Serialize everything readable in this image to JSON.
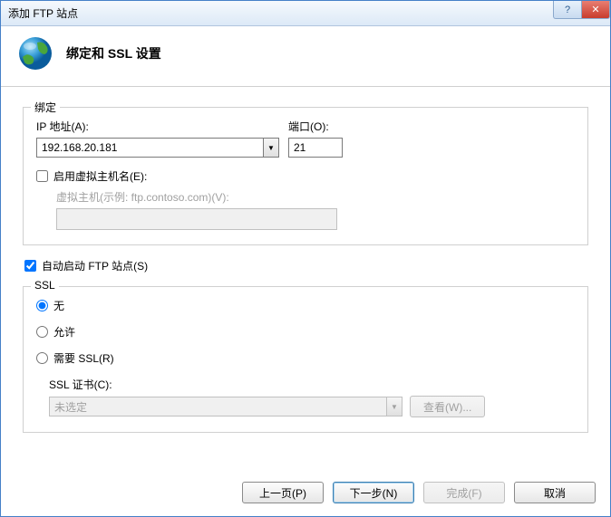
{
  "window": {
    "title": "添加 FTP 站点"
  },
  "header": {
    "title": "绑定和 SSL 设置"
  },
  "binding": {
    "legend": "绑定",
    "ip_label": "IP 地址(A):",
    "ip_value": "192.168.20.181",
    "port_label": "端口(O):",
    "port_value": "21",
    "vhost_enable_label": "启用虚拟主机名(E):",
    "vhost_label": "虚拟主机(示例: ftp.contoso.com)(V):"
  },
  "autostart": {
    "label": "自动启动 FTP 站点(S)"
  },
  "ssl": {
    "legend": "SSL",
    "opt_none": "无",
    "opt_allow": "允许",
    "opt_require": "需要 SSL(R)",
    "cert_label": "SSL 证书(C):",
    "cert_value": "未选定",
    "view_label": "查看(W)..."
  },
  "footer": {
    "prev": "上一页(P)",
    "next": "下一步(N)",
    "finish": "完成(F)",
    "cancel": "取消"
  },
  "titlebar": {
    "help": "?",
    "close": "✕"
  }
}
